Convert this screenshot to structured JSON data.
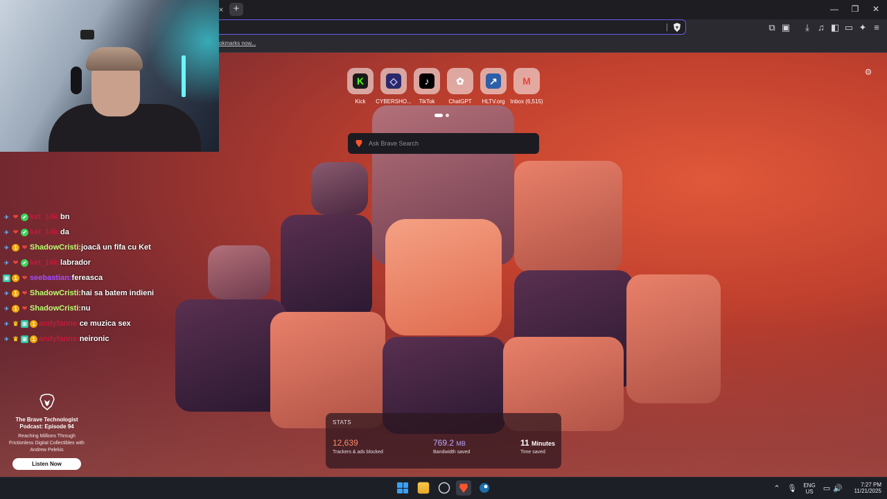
{
  "browser": {
    "tab_close_glyph": "×",
    "new_tab_glyph": "+",
    "window": {
      "minimize": "—",
      "maximize": "❐",
      "close": "✕"
    },
    "address_placeholder": "",
    "bookmarks_link": "okmarks now...",
    "toolbar_icons": [
      "extensions-icon",
      "reader-mode-icon",
      "downloads-icon",
      "media-icon",
      "sidebar-icon",
      "wallet-icon",
      "leo-ai-icon",
      "menu-icon"
    ]
  },
  "ntp": {
    "top_sites": [
      {
        "label": "Kick",
        "glyph": "K",
        "color": "#1a1a1a",
        "fg": "#53fc18"
      },
      {
        "label": "CYBERSHO...",
        "glyph": "◇",
        "color": "#2a2a6a",
        "fg": "#c9c2ff"
      },
      {
        "label": "TikTok",
        "glyph": "♪",
        "color": "#000000",
        "fg": "#ffffff"
      },
      {
        "label": "ChatGPT",
        "glyph": "✿",
        "color": "transparent",
        "fg": "#ffffff"
      },
      {
        "label": "HLTV.org",
        "glyph": "↗",
        "color": "#2d5fa8",
        "fg": "#ffffff"
      },
      {
        "label": "Inbox (6,515)",
        "glyph": "M",
        "color": "transparent",
        "fg": "#ea4335"
      }
    ],
    "search_placeholder": "Ask Brave Search",
    "stats": {
      "heading": "STATS",
      "items": [
        {
          "value": "12,639",
          "unit": "",
          "caption": "Trackers & ads blocked",
          "color": "#ff8a6a"
        },
        {
          "value": "769.2",
          "unit": "MB",
          "caption": "Bandwidth saved",
          "color": "#b9a6ff"
        },
        {
          "value": "11",
          "unit": "Minutes",
          "caption": "Time saved",
          "color": "#ffffff"
        }
      ]
    },
    "promo": {
      "title": "The Brave Technologist Podcast: Episode 94",
      "subtitle": "Reaching Millions Through Frictionless Digital Collectibles with Andrew Pelekis",
      "button": "Listen Now"
    }
  },
  "chat": [
    {
      "badges": [
        "mod",
        "heart",
        "verified"
      ],
      "user": "ket_14k",
      "user_color": "#c01b3a",
      "message": "bn"
    },
    {
      "badges": [
        "mod",
        "heart",
        "verified"
      ],
      "user": "ket_14k",
      "user_color": "#c01b3a",
      "message": "da"
    },
    {
      "badges": [
        "mod",
        "sub",
        "heart"
      ],
      "user": "ShadowCristi",
      "user_color": "#b8ff72",
      "message": "joacă un fifa cu Ket"
    },
    {
      "badges": [
        "mod",
        "heart",
        "verified"
      ],
      "user": "ket_14k",
      "user_color": "#c01b3a",
      "message": "labrador"
    },
    {
      "badges": [
        "gift",
        "sub",
        "heart"
      ],
      "user": "seebastian",
      "user_color": "#a04cff",
      "message": "fereasca"
    },
    {
      "badges": [
        "mod",
        "sub",
        "heart"
      ],
      "user": "ShadowCristi",
      "user_color": "#b8ff72",
      "message": "hai sa batem indieni"
    },
    {
      "badges": [
        "mod",
        "sub",
        "heart"
      ],
      "user": "ShadowCristi",
      "user_color": "#b8ff72",
      "message": "nu"
    },
    {
      "badges": [
        "mod",
        "crown",
        "gift",
        "sub"
      ],
      "user": "andyfanne",
      "user_color": "#c01b3a",
      "message": "ce muzica sex"
    },
    {
      "badges": [
        "mod",
        "crown",
        "gift",
        "sub"
      ],
      "user": "andyfanne",
      "user_color": "#c01b3a",
      "message": "neironic"
    }
  ],
  "taskbar": {
    "apps": [
      "start-icon",
      "file-explorer-icon",
      "obs-icon",
      "brave-icon",
      "steam-icon"
    ],
    "lang_top": "ENG",
    "lang_bottom": "US",
    "time": "7:27 PM",
    "date": "11/21/2025"
  }
}
